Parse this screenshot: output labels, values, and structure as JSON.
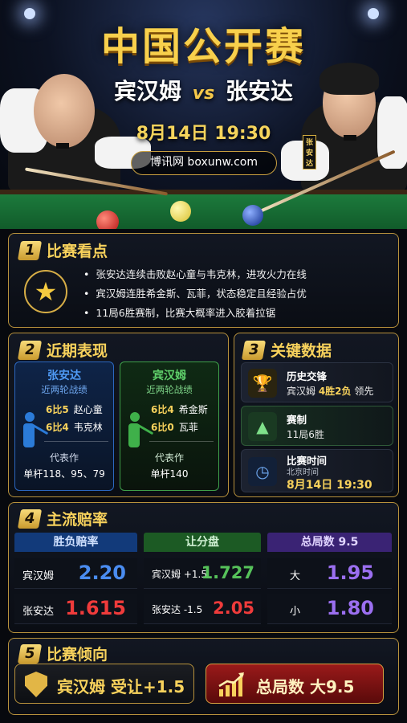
{
  "header": {
    "title": "中国公开赛",
    "player_left": "宾汉姆",
    "vs": "vs",
    "player_right": "张安达",
    "date": "8月14日 19:30",
    "site": "博讯网 boxunw.com",
    "badge_right": "张安达"
  },
  "section1": {
    "num": "1",
    "title": "比赛看点",
    "icon": "star-icon",
    "bullets": [
      "张安达连续击败赵心童与韦克林，进攻火力在线",
      "宾汉姆连胜希金斯、瓦菲，状态稳定且经验占优",
      "11局6胜赛制，比赛大概率进入胶着拉锯"
    ]
  },
  "section2": {
    "num": "2",
    "title": "近期表现",
    "left": {
      "name": "张安达",
      "sub": "近两轮战绩",
      "rows": [
        {
          "score": "6比5",
          "opp": "赵心童"
        },
        {
          "score": "6比4",
          "opp": "韦克林"
        }
      ],
      "rep_label": "代表作",
      "rep_value": "单杆118、95、79",
      "color": "#2b7bd8"
    },
    "right": {
      "name": "宾汉姆",
      "sub": "近两轮战绩",
      "rows": [
        {
          "score": "6比4",
          "opp": "希金斯"
        },
        {
          "score": "6比0",
          "opp": "瓦菲"
        }
      ],
      "rep_label": "代表作",
      "rep_value": "单杆140",
      "color": "#3fb04a"
    }
  },
  "section3": {
    "num": "3",
    "title": "关键数据",
    "items": [
      {
        "icon": "trophy-icon",
        "title": "历史交锋",
        "value_prefix": "宾汉姆 ",
        "value_highlight": "4胜2负",
        "value_suffix": " 领先"
      },
      {
        "icon": "billiard-rack-icon",
        "title": "赛制",
        "value": "11局6胜"
      },
      {
        "icon": "clock-icon",
        "title": "比赛时间",
        "sub": "北京时间",
        "value": "8月14日 19:30"
      }
    ]
  },
  "section4": {
    "num": "4",
    "title": "主流赔率",
    "columns": [
      {
        "head": "胜负赔率",
        "rows": [
          {
            "label": "宾汉姆",
            "value": "2.20",
            "color": "#4a8cf0"
          },
          {
            "label": "张安达",
            "value": "1.615",
            "color": "#ef3b3b"
          }
        ]
      },
      {
        "head": "让分盘",
        "rows": [
          {
            "label": "宾汉姆 +1.5",
            "value": "1.727",
            "color": "#56c25a"
          },
          {
            "label": "张安达 -1.5",
            "value": "2.05",
            "color": "#ef3b3b"
          }
        ]
      },
      {
        "head": "总局数 9.5",
        "rows": [
          {
            "label": "大",
            "value": "1.95",
            "color": "#9b6ff0"
          },
          {
            "label": "小",
            "value": "1.80",
            "color": "#9b6ff0"
          }
        ]
      }
    ]
  },
  "section5": {
    "num": "5",
    "title": "比赛倾向",
    "pick_left": "宾汉姆 受让+1.5",
    "pick_right": "总局数 大9.5"
  }
}
